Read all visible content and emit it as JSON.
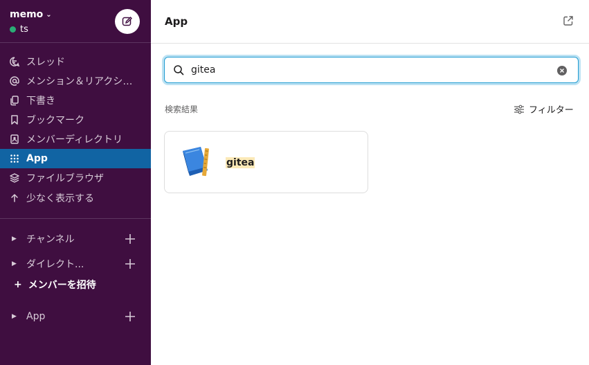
{
  "workspace": {
    "name": "memo",
    "user": "ts"
  },
  "nav": [
    {
      "label": "スレッド",
      "icon": "threads-icon"
    },
    {
      "label": "メンション＆リアクション",
      "icon": "mention-icon"
    },
    {
      "label": "下書き",
      "icon": "drafts-icon"
    },
    {
      "label": "ブックマーク",
      "icon": "bookmark-icon"
    },
    {
      "label": "メンバーディレクトリ",
      "icon": "directory-icon"
    },
    {
      "label": "App",
      "icon": "apps-grid-icon",
      "active": true
    },
    {
      "label": "ファイルブラウザ",
      "icon": "files-icon"
    },
    {
      "label": "少なく表示する",
      "icon": "arrow-up-icon"
    }
  ],
  "sections": {
    "channels": "チャンネル",
    "dms": "ダイレクト...",
    "invite": "メンバーを招待",
    "apps": "App"
  },
  "main": {
    "title": "App",
    "search_value": "gitea",
    "results_label": "検索結果",
    "filter_label": "フィルター"
  },
  "results": [
    {
      "name": "gitea",
      "icon": "notebook-app-icon"
    }
  ],
  "colors": {
    "sidebar": "#3f0e40",
    "active": "#1164a3",
    "presence": "#2bac76",
    "focus": "#1d9bd1",
    "highlight": "#fbe9b7"
  }
}
